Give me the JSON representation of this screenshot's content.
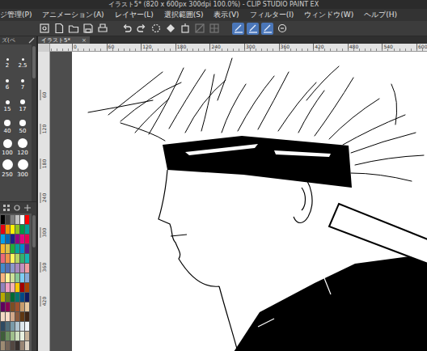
{
  "window": {
    "title": "イラスト5* (820 x 600px 300dpi 100.0%) - CLIP STUDIO PAINT EX"
  },
  "menu": [
    "ジ管理(P)",
    "アニメーション(A)",
    "レイヤー(L)",
    "選択範囲(S)",
    "表示(V)",
    "フィルター(I)",
    "ウィンドウ(W)",
    "ヘルプ(H)"
  ],
  "toolbar": [
    {
      "kind": "panel",
      "selected": false
    },
    {
      "kind": "new",
      "selected": false
    },
    {
      "kind": "open",
      "selected": false
    },
    {
      "kind": "save",
      "selected": false
    },
    {
      "kind": "print",
      "selected": false
    },
    {
      "kind": "undo",
      "selected": false
    },
    {
      "kind": "redo",
      "selected": false
    },
    {
      "kind": "spinner",
      "selected": false
    },
    {
      "kind": "fill",
      "selected": false
    },
    {
      "kind": "transform",
      "selected": false
    },
    {
      "kind": "crop",
      "selected": false
    },
    {
      "kind": "grid",
      "selected": false
    },
    {
      "kind": "pen",
      "selected": true
    },
    {
      "kind": "pen",
      "selected": true
    },
    {
      "kind": "pen",
      "selected": true
    },
    {
      "kind": "edit",
      "selected": false
    }
  ],
  "brush_size": {
    "tab": "ズ(ペ",
    "sizes": [
      {
        "value": "2",
        "selected": false
      },
      {
        "value": "2.5",
        "selected": false
      },
      {
        "value": "6",
        "selected": false
      },
      {
        "value": "7",
        "selected": false
      },
      {
        "value": "15",
        "selected": false
      },
      {
        "value": "17",
        "selected": false
      },
      {
        "value": "40",
        "selected": false
      },
      {
        "value": "50",
        "selected": false
      },
      {
        "value": "100",
        "selected": false
      },
      {
        "value": "120",
        "selected": false
      },
      {
        "value": "250",
        "selected": false
      },
      {
        "value": "300",
        "selected": false
      }
    ]
  },
  "document_tabs": [
    {
      "label": "イラスト5*",
      "close": "×",
      "selected": true
    }
  ],
  "ruler": {
    "top": [
      "0",
      "60",
      "120",
      "180",
      "240",
      "300",
      "360",
      "420",
      "480",
      "540",
      "600"
    ],
    "left": [
      "60",
      "120",
      "180",
      "240",
      "300",
      "360",
      "420"
    ]
  },
  "palette": {
    "colors": [
      "#000000",
      "#404040",
      "#808080",
      "#c0c0c0",
      "#ffffff",
      "#ff0000",
      "#e60012",
      "#f39800",
      "#fff100",
      "#8fc31f",
      "#009944",
      "#009e96",
      "#00a0e9",
      "#0068b7",
      "#1d2088",
      "#920783",
      "#e4007f",
      "#e5004f",
      "#f8b62d",
      "#d7c447",
      "#22ac38",
      "#00a29a",
      "#0086d1",
      "#601986",
      "#eb6877",
      "#f19149",
      "#fff45c",
      "#b3d465",
      "#32b16c",
      "#13b5b1",
      "#448aca",
      "#556fb5",
      "#8c97cb",
      "#aa89bd",
      "#c490bf",
      "#f29c9f",
      "#f6b37f",
      "#fff799",
      "#cce198",
      "#89c997",
      "#7ecef4",
      "#88abda",
      "#8f82bc",
      "#f19ec2",
      "#f5b2b2",
      "#fcc800",
      "#a40000",
      "#a84200",
      "#b7aa00",
      "#5a7c1f",
      "#006934",
      "#00736d",
      "#004986",
      "#0f1a5e",
      "#5f005e",
      "#8a0052",
      "#7d4e24",
      "#a0522d",
      "#c69c6d",
      "#e6c8a0",
      "#f2d9c4",
      "#fadcc8",
      "#d2a88a",
      "#8b5a3c",
      "#603813",
      "#3c2415",
      "#2e4a62",
      "#4f6d7a",
      "#7a9aa8",
      "#b0c4d0",
      "#dde6ec",
      "#f0f4f7",
      "#3f5e3a",
      "#6b8f5e",
      "#9fbf8c",
      "#cfe0c0",
      "#e9f1e0",
      "#c7b299",
      "#9e8b73",
      "#736357",
      "#534741",
      "#362f2d",
      "#998675",
      "#ded4c5"
    ]
  }
}
